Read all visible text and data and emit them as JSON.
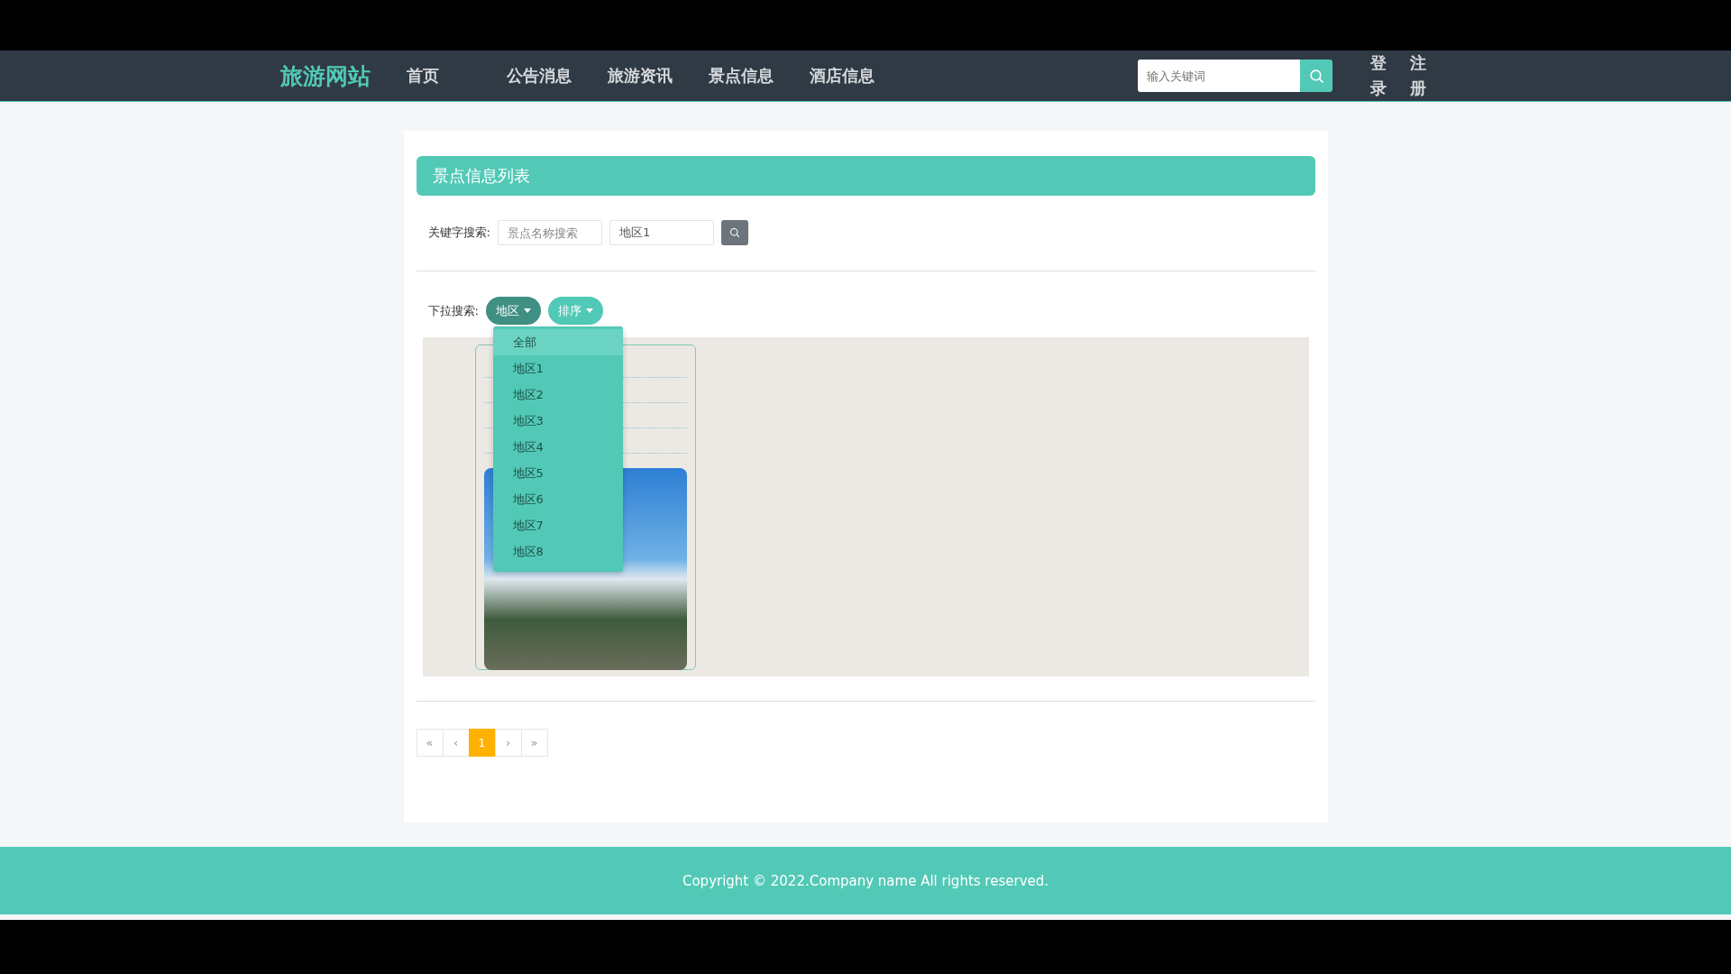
{
  "nav": {
    "logo": "旅游网站",
    "items": [
      {
        "label": "首页"
      },
      {
        "label": "公告消息"
      },
      {
        "label": "旅游资讯"
      },
      {
        "label": "景点信息"
      },
      {
        "label": "酒店信息"
      }
    ],
    "search": {
      "placeholder": "输入关键词"
    },
    "auth": [
      {
        "label": "登录"
      },
      {
        "label": "注册"
      }
    ]
  },
  "panel": {
    "title": "景点信息列表",
    "keyword_search": {
      "label": "关键字搜索:",
      "fields": [
        {
          "placeholder": "景点名称搜索"
        },
        {
          "value": "地区1"
        }
      ]
    },
    "dropdown_search": {
      "label": "下拉搜索:",
      "buttons": [
        {
          "label": "地区",
          "open": true
        },
        {
          "label": "排序",
          "open": false
        }
      ],
      "menu": [
        {
          "label": "全部",
          "selected": true
        },
        {
          "label": "地区1",
          "selected": false
        },
        {
          "label": "地区2",
          "selected": false
        },
        {
          "label": "地区3",
          "selected": false
        },
        {
          "label": "地区4",
          "selected": false
        },
        {
          "label": "地区5",
          "selected": false
        },
        {
          "label": "地区6",
          "selected": false
        },
        {
          "label": "地区7",
          "selected": false
        },
        {
          "label": "地区8",
          "selected": false
        }
      ]
    },
    "pagination": [
      {
        "label": "«",
        "selected": false
      },
      {
        "label": "‹",
        "selected": false
      },
      {
        "label": "1",
        "selected": true
      },
      {
        "label": "›",
        "selected": false
      },
      {
        "label": "»",
        "selected": false
      }
    ]
  },
  "footer": {
    "text": "Copyright © 2022.Company name All rights reserved."
  }
}
